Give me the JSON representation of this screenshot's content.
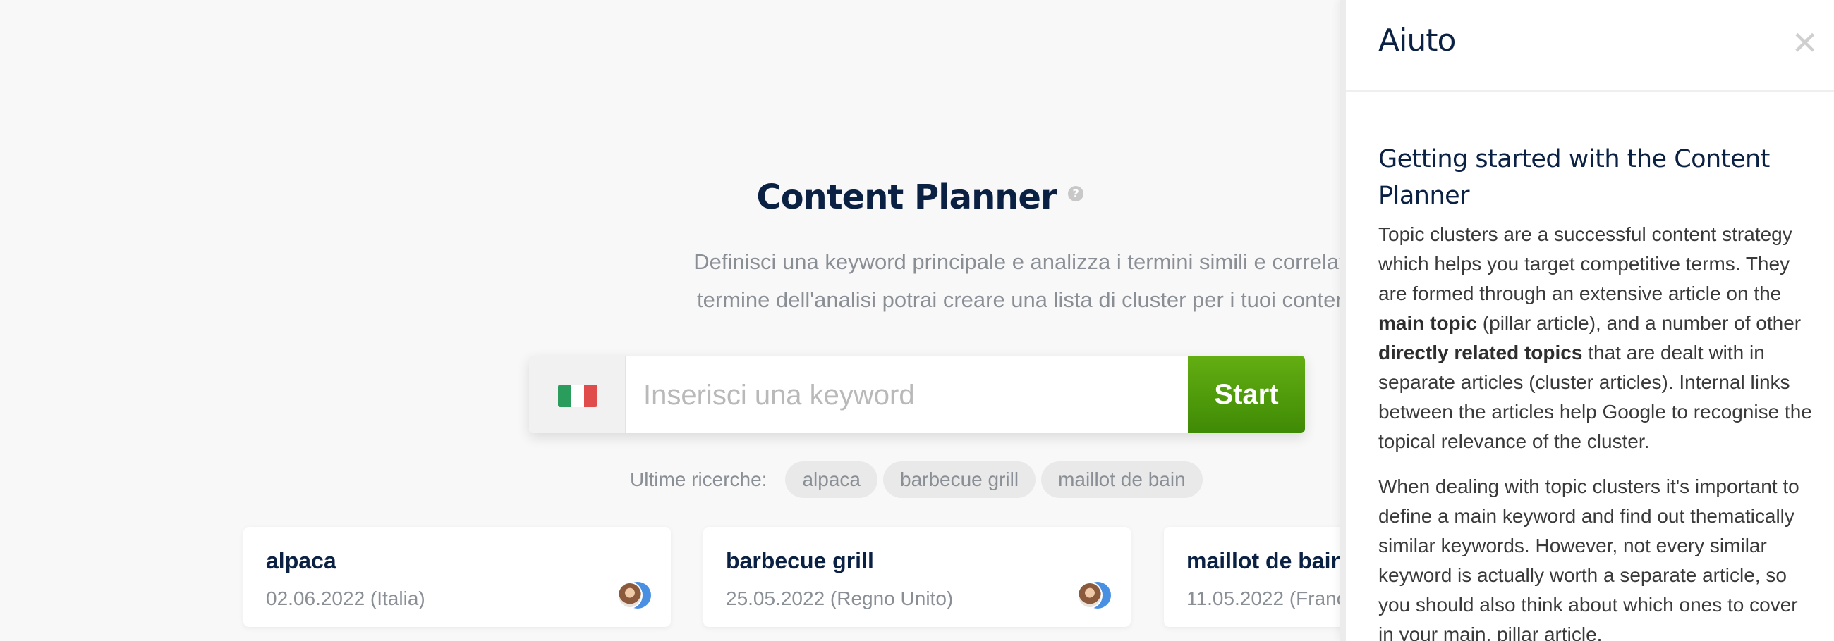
{
  "main": {
    "title": "Content Planner",
    "help_glyph": "?",
    "subtitle_line1": "Definisci una keyword principale e analizza i termini simili e correlati. Al",
    "subtitle_line2": "termine dell'analisi potrai creare una lista di cluster per i tuoi contenuti.",
    "search": {
      "flag_icon": "italy-flag-icon",
      "flag_colors": [
        "#2a9d5c",
        "#ffffff",
        "#e04b4b"
      ],
      "placeholder": "Inserisci una keyword",
      "start_label": "Start",
      "start_color": "#4e9a0a"
    },
    "recent": {
      "label": "Ultime ricerche:",
      "chips": [
        "alpaca",
        "barbecue grill",
        "maillot de bain"
      ]
    },
    "cards": [
      {
        "title": "alpaca",
        "date": "02.06.2022 (Italia)"
      },
      {
        "title": "barbecue grill",
        "date": "25.05.2022 (Regno Unito)"
      },
      {
        "title": "maillot de bain",
        "date": "11.05.2022 (Franc"
      }
    ]
  },
  "help_panel": {
    "title": "Aiuto",
    "close_glyph": "✕",
    "heading": "Getting started with the Content Planner",
    "p1_a": "Topic clusters are a successful content strategy which helps you target competitive terms. They are formed through an extensive article on the ",
    "p1_b": "main topic",
    "p1_c": " (pillar article), and a number of other ",
    "p1_d": "directly related topics",
    "p1_e": " that are dealt with in separate articles (cluster articles). Internal links between the articles help Google to recognise the topical relevance of the cluster.",
    "p2": "When dealing with topic clusters it's important to define a main keyword and find out thematically similar keywords. However, not every similar keyword is actually worth a separate article, so you should also think about which ones to cover in your main, pillar article."
  }
}
